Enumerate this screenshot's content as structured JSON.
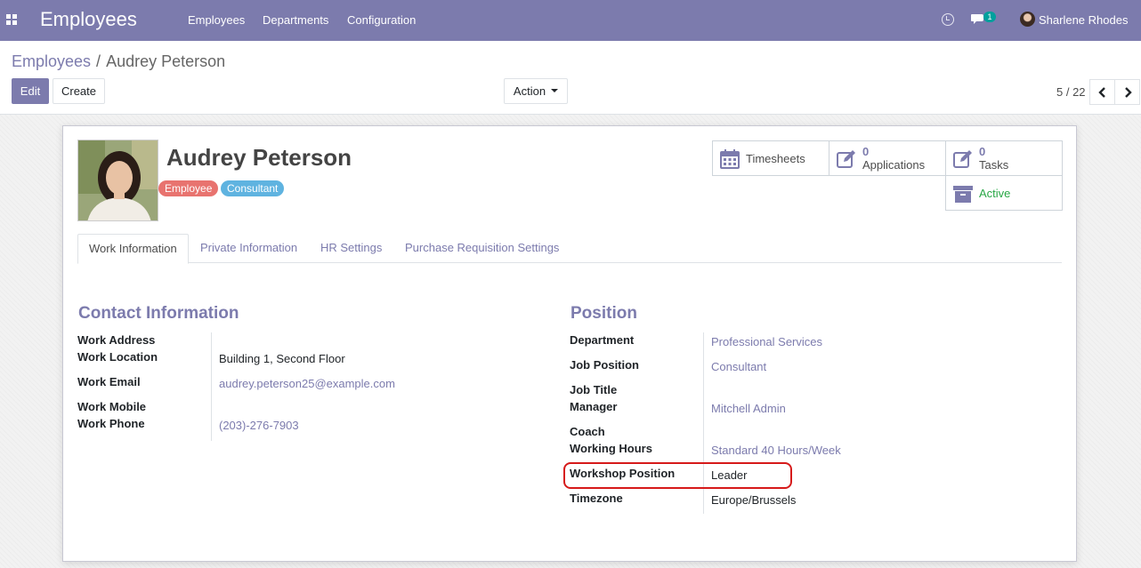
{
  "navbar": {
    "app_title": "Employees",
    "menu": [
      "Employees",
      "Departments",
      "Configuration"
    ],
    "message_count": "1",
    "user_name": "Sharlene Rhodes"
  },
  "control_panel": {
    "breadcrumb_parent": "Employees",
    "breadcrumb_separator": "/",
    "breadcrumb_current": "Audrey Peterson",
    "edit_label": "Edit",
    "create_label": "Create",
    "action_label": "Action",
    "pager": "5 / 22"
  },
  "employee": {
    "name": "Audrey Peterson",
    "tags": [
      {
        "label": "Employee",
        "color": "#e8736f"
      },
      {
        "label": "Consultant",
        "color": "#5fb3e0"
      }
    ]
  },
  "smart_buttons": {
    "timesheets": {
      "label": "Timesheets"
    },
    "applications": {
      "value": "0",
      "label": "Applications"
    },
    "tasks": {
      "value": "0",
      "label": "Tasks"
    },
    "status": {
      "label": "Active",
      "color": "#28a745"
    }
  },
  "tabs": [
    "Work Information",
    "Private Information",
    "HR Settings",
    "Purchase Requisition Settings"
  ],
  "contact": {
    "title": "Contact Information",
    "work_address_label": "Work Address",
    "work_location_label": "Work Location",
    "work_location_value": "Building 1, Second Floor",
    "work_email_label": "Work Email",
    "work_email_value": "audrey.peterson25@example.com",
    "work_mobile_label": "Work Mobile",
    "work_phone_label": "Work Phone",
    "work_phone_value": "(203)-276-7903"
  },
  "position": {
    "title": "Position",
    "department_label": "Department",
    "department_value": "Professional Services",
    "job_position_label": "Job Position",
    "job_position_value": "Consultant",
    "job_title_label": "Job Title",
    "manager_label": "Manager",
    "manager_value": "Mitchell Admin",
    "coach_label": "Coach",
    "working_hours_label": "Working Hours",
    "working_hours_value": "Standard 40 Hours/Week",
    "workshop_position_label": "Workshop Position",
    "workshop_position_value": "Leader",
    "timezone_label": "Timezone",
    "timezone_value": "Europe/Brussels"
  },
  "colors": {
    "brand": "#7c7bad",
    "highlight": "#d61a1a"
  }
}
